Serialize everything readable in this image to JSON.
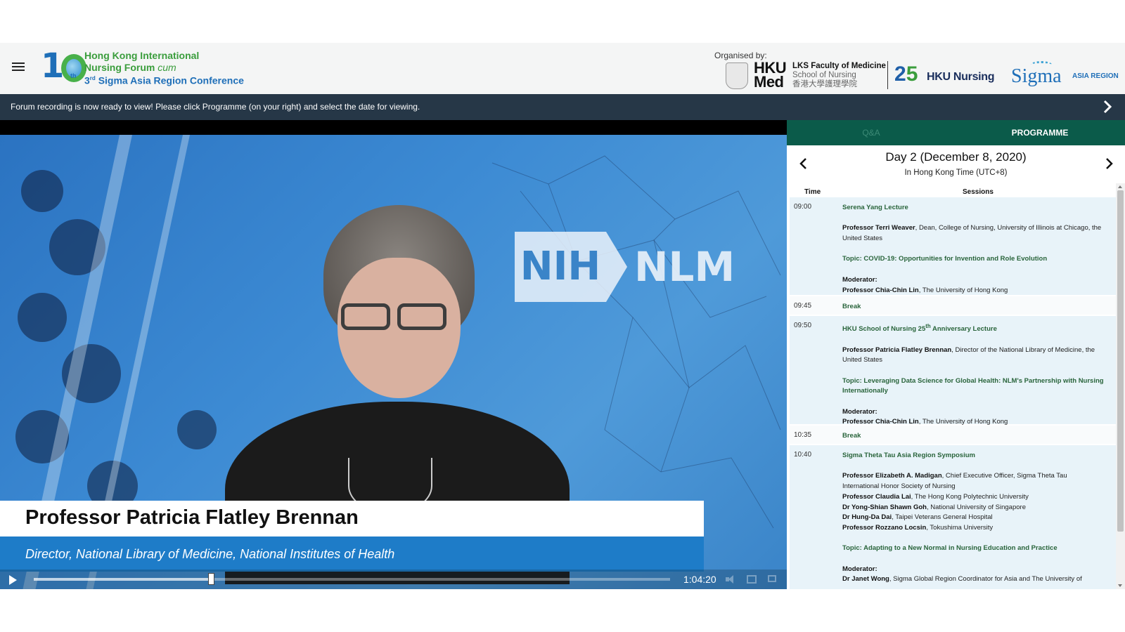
{
  "header": {
    "menu_icon": "hamburger-icon",
    "logo": {
      "number": "10",
      "ordinal": "th",
      "line1": "Hong Kong International",
      "line2": "Nursing Forum",
      "line2_italic": "cum",
      "line3_num": "3",
      "line3_sup": "rd",
      "line3_text": "Sigma Asia Region Conference"
    },
    "organised_by": "Organised by:",
    "org_hkumed": "HKU Med",
    "org_lks_line1": "LKS Faculty of Medicine",
    "org_lks_line2": "School of Nursing",
    "org_lks_line3": "香港大學護理學院",
    "org_25_2": "2",
    "org_25_5": "5",
    "org_hkunursing": "HKU Nursing",
    "org_sigma": "Sigma",
    "org_asia": "ASIA REGION"
  },
  "notice": {
    "text": "Forum recording is now ready to view! Please click Programme (on your right) and select the date for viewing.",
    "next_icon": "chevron-right-icon"
  },
  "video": {
    "nih": "NIH",
    "nlm": "NLM",
    "speaker_name": "Professor Patricia Flatley Brennan",
    "speaker_title": "Director, National Library of Medicine, National Institutes of Health",
    "time": "1:04:20",
    "progress_fraction": 0.28
  },
  "panel": {
    "tabs": [
      "Q&A",
      "PROGRAMME"
    ],
    "active_tab": "PROGRAMME",
    "day_title": "Day 2 (December 8, 2020)",
    "day_sub": "In Hong Kong Time (UTC+8)",
    "col_time": "Time",
    "col_sessions": "Sessions",
    "rows": [
      {
        "time": "09:00",
        "title": "Serena Yang Lecture",
        "speaker_name": "Professor Terri Weaver",
        "speaker_rest": ", Dean, College of Nursing, University of Illinois at Chicago, the United States",
        "topic": "Topic: COVID-19: Opportunities for Invention and Role Evolution",
        "moderator_label": "Moderator:",
        "moderator_name": "Professor Chia-Chin Lin",
        "moderator_rest": ", The University of Hong Kong"
      },
      {
        "time": "09:45",
        "title": "Break"
      },
      {
        "time": "09:50",
        "title_pre": "HKU School of Nursing 25",
        "title_sup": "th",
        "title_post": " Anniversary Lecture",
        "speaker_name": "Professor Patricia Flatley Brennan",
        "speaker_rest": ", Director of the National Library of Medicine, the United States",
        "topic": "Topic: Leveraging Data Science for Global Health: NLM's Partnership with Nursing Internationally",
        "moderator_label": "Moderator:",
        "moderator_name": "Professor Chia-Chin Lin",
        "moderator_rest": ", The University of Hong Kong"
      },
      {
        "time": "10:35",
        "title": "Break"
      },
      {
        "time": "10:40",
        "title": "Sigma Theta Tau Asia Region Symposium",
        "speakers": [
          {
            "name": "Professor Elizabeth A. Madigan",
            "rest": ", Chief Executive Officer, Sigma Theta Tau International Honor Society of Nursing"
          },
          {
            "name": "Professor Claudia Lai",
            "rest": ", The Hong Kong Polytechnic University"
          },
          {
            "name": "Dr Yong-Shian Shawn Goh",
            "rest": ", National University of Singapore"
          },
          {
            "name": "Dr Hung-Da Dai",
            "rest": ", Taipei Veterans General Hospital"
          },
          {
            "name": "Professor Rozzano Locsin",
            "rest": ", Tokushima University"
          }
        ],
        "topic": "Topic: Adapting to a New Normal in Nursing Education and Practice",
        "moderator_label": "Moderator:",
        "moderator_name": "Dr Janet Wong",
        "moderator_rest": ", Sigma Global Region Coordinator for Asia and The University of"
      }
    ]
  }
}
